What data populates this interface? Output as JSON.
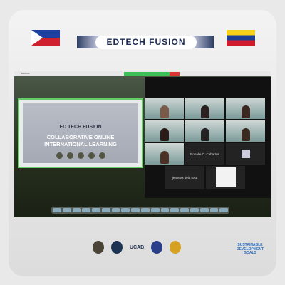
{
  "header": {
    "title": "EDTECH FUSION"
  },
  "slide": {
    "brand": "ED TECH FUSION",
    "title_line1": "COLLABORATIVE ONLINE",
    "title_line2": "INTERNATIONAL LEARNING"
  },
  "menubar": {
    "app": "zoom.us"
  },
  "participants": [
    "Ronalie C. Cabarrus",
    "jeaneva dela rosa"
  ],
  "footer": {
    "ucab": "UCAB",
    "sdg": "SUSTAINABLE DEVELOPMENT GOALS"
  },
  "colors": {
    "accent": "#1d2d52",
    "zoom_green": "#3cc05a"
  }
}
